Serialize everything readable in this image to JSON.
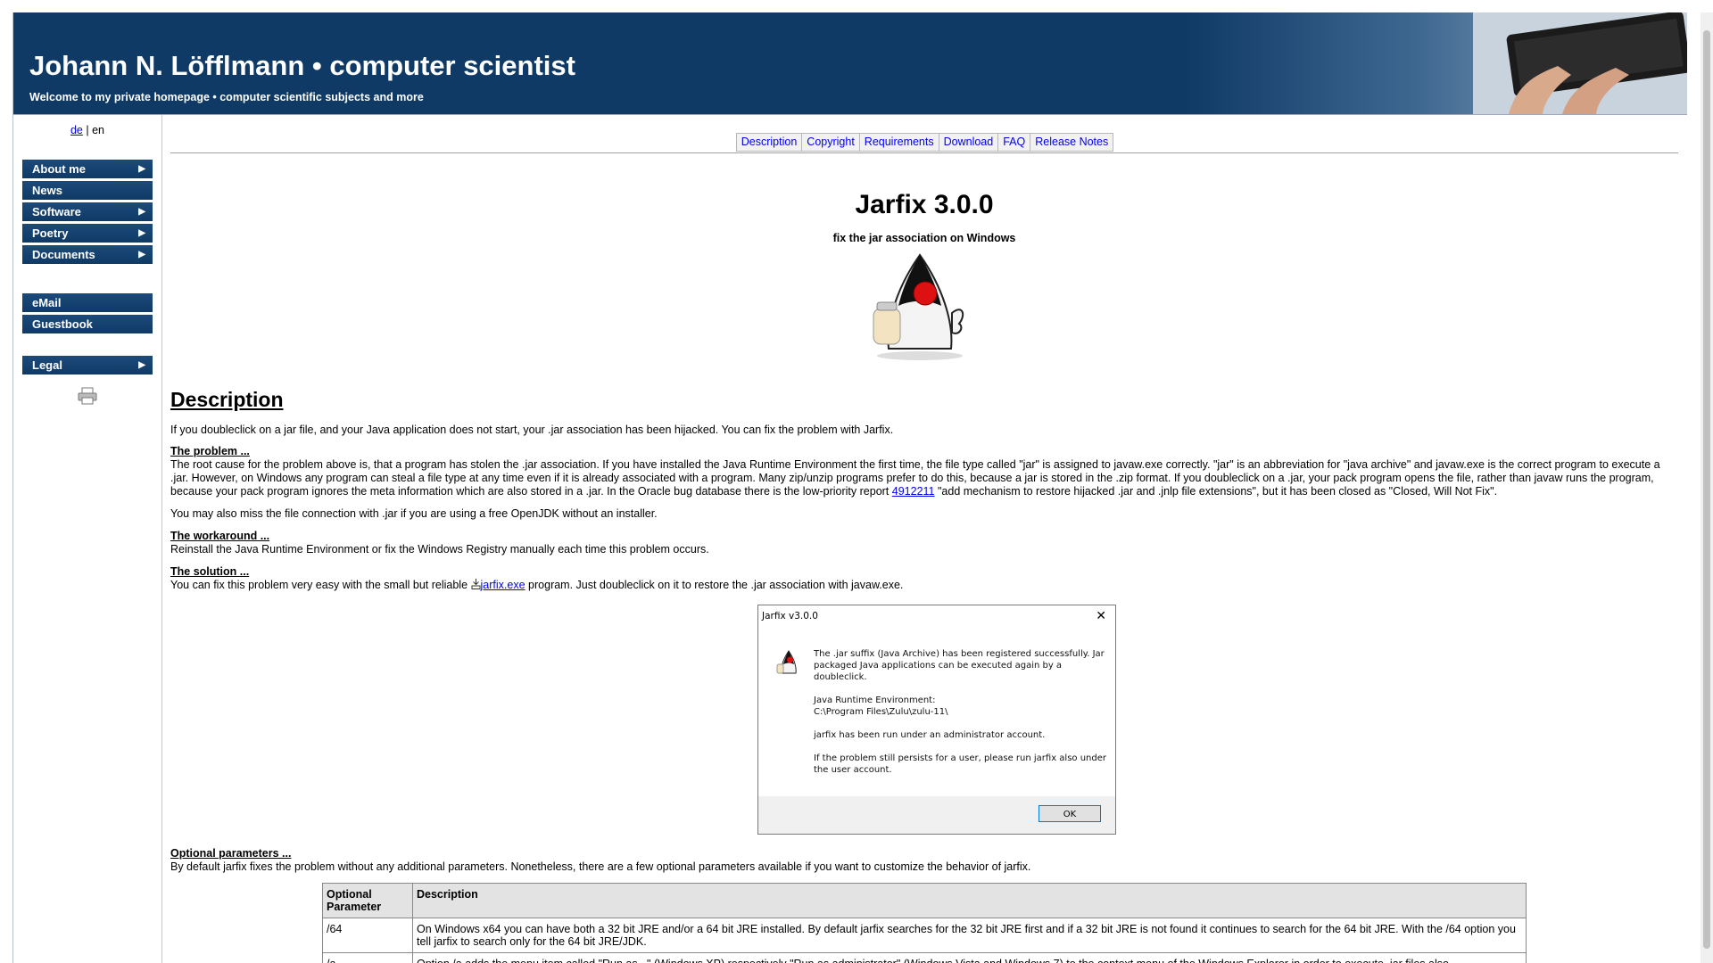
{
  "header": {
    "title": "Johann N. Löfflmann • computer scientist",
    "subtitle": "Welcome to my private homepage • computer scientific subjects and more"
  },
  "language": {
    "de": "de",
    "separator": "|",
    "en": "en"
  },
  "menu_main": [
    {
      "label": "About me",
      "submenu": true
    },
    {
      "label": "News",
      "submenu": false
    },
    {
      "label": "Software",
      "submenu": true
    },
    {
      "label": "Poetry",
      "submenu": true
    },
    {
      "label": "Documents",
      "submenu": true
    }
  ],
  "menu_contact": [
    {
      "label": "eMail"
    },
    {
      "label": "Guestbook"
    }
  ],
  "menu_legal": {
    "label": "Legal",
    "arrow": "▶"
  },
  "arrow_glyph": "▶",
  "tabs": [
    "Description",
    "Copyright",
    "Requirements",
    "Download",
    "FAQ",
    "Release Notes"
  ],
  "app": {
    "title": "Jarfix 3.0.0",
    "subtitle": "fix the jar association on Windows"
  },
  "description": {
    "heading": "Description",
    "intro": "If you doubleclick on a jar file, and your Java application does not start, your .jar association has been hijacked. You can fix the problem with Jarfix.",
    "problem_heading": "The problem ...",
    "problem_text": "The root cause for the problem above is, that a program has stolen the .jar association. If you have installed the Java Runtime Environment the first time, the file type called \"jar\" is assigned to javaw.exe correctly. \"jar\" is an abbreviation for \"java archive\" and javaw.exe is the correct program to execute a .jar. However, on Windows any program can steal a file type at any time even if it is already associated with a program. Many zip/unzip programs prefer to do this, because a jar is stored in the .zip format.  If you doubleclick on a .jar, your pack program opens the file, rather than javaw runs the program, because your pack program ignores the meta information which are also stored in a .jar. In the Oracle bug database there is the low-priority report",
    "bug_link": "4912211",
    "problem_text_after": "\"add mechanism to restore hijacked .jar and .jnlp file extensions\", but it has been closed as \"Closed, Will Not Fix\".",
    "openjdk_text": "You may also miss the file connection with .jar if you are using a free OpenJDK without an installer.",
    "workaround_heading": "The workaround ...",
    "workaround_text": "Reinstall the Java Runtime Environment or fix the Windows Registry manually each time this problem occurs.",
    "solution_heading": "The solution ...",
    "solution_before": "You can fix this problem very easy with the small but reliable",
    "solution_link": "jarfix.exe",
    "solution_after": "program. Just doubleclick on it to restore the .jar association with javaw.exe.",
    "optional_heading": "Optional parameters ...",
    "optional_text": "By default jarfix fixes the problem without any additional parameters. Nonetheless, there are a few optional parameters available if you want to customize the behavior of jarfix."
  },
  "dialog": {
    "title": "Jarfix v3.0.0",
    "close": "✕",
    "line1": "The .jar suffix (Java Archive) has been registered successfully. Jar packaged Java applications can be executed again by a doubleclick.",
    "line2a": "Java Runtime Environment:",
    "line2b": "C:\\Program Files\\Zulu\\zulu-11\\",
    "line3": "jarfix has been run under an administrator account.",
    "line4": "If the problem still persists for a user, please run jarfix also under the user account.",
    "ok": "OK"
  },
  "params_table": {
    "header_param": "Optional Parameter",
    "header_desc": "Description",
    "rows": [
      {
        "param": "/64",
        "desc": "On Windows x64 you can have both a 32 bit JRE and/or a 64 bit JRE installed. By default jarfix searches for the 32 bit JRE first and if a 32 bit JRE is not found it continues to search for the 64 bit JRE. With the /64 option you tell jarfix to search only for the 64 bit JRE/JDK."
      },
      {
        "param": "/a",
        "desc": "Option /a adds the menu item called \"Run as...\" (Windows XP) respectively \"Run as administrator\" (Windows Vista and Windows 7) to the context menu of the Windows Explorer in order to execute .jar files also"
      }
    ]
  }
}
